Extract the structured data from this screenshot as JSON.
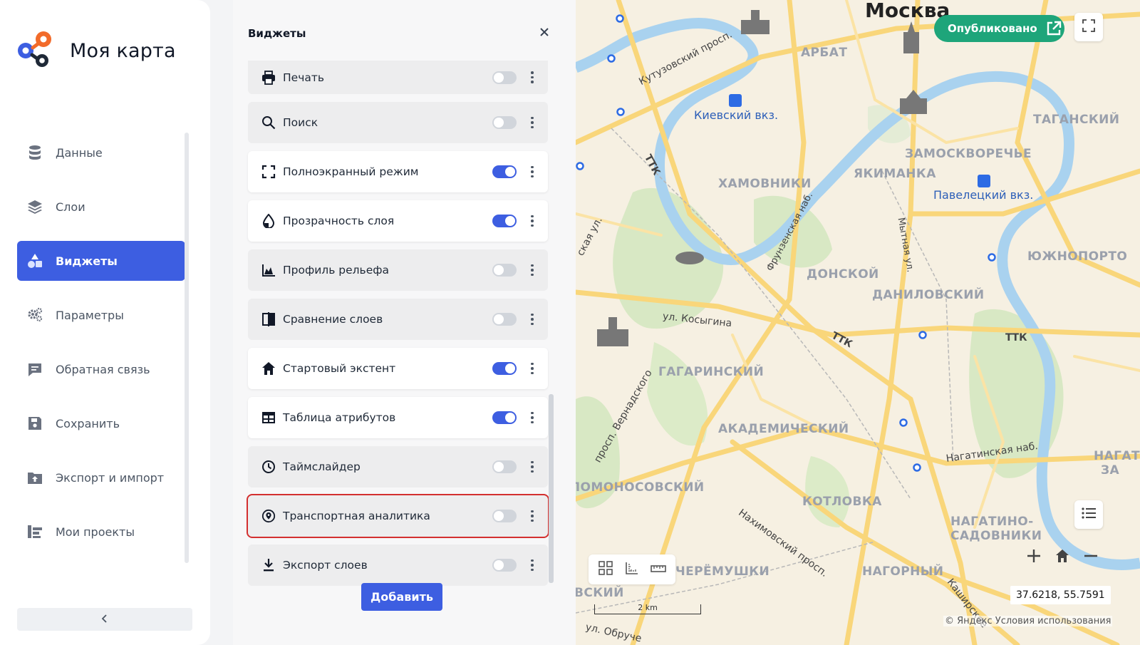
{
  "brand": {
    "title": "Моя карта"
  },
  "nav": {
    "items": [
      {
        "label": "Данные",
        "icon": "database-icon",
        "active": false
      },
      {
        "label": "Слои",
        "icon": "layers-icon",
        "active": false
      },
      {
        "label": "Виджеты",
        "icon": "widgets-icon",
        "active": true
      },
      {
        "label": "Параметры",
        "icon": "gears-icon",
        "active": false
      },
      {
        "label": "Обратная связь",
        "icon": "chat-icon",
        "active": false
      },
      {
        "label": "Сохранить",
        "icon": "save-icon",
        "active": false
      },
      {
        "label": "Экспорт и импорт",
        "icon": "folder-upload-icon",
        "active": false
      },
      {
        "label": "Мои проекты",
        "icon": "projects-icon",
        "active": false
      }
    ],
    "collapse_icon": "chevron-left-icon"
  },
  "panel": {
    "title": "Виджеты",
    "close_icon": "close-icon",
    "add_label": "Добавить",
    "widgets": [
      {
        "label": "Печать",
        "icon": "printer-icon",
        "enabled": false
      },
      {
        "label": "Поиск",
        "icon": "search-icon",
        "enabled": false
      },
      {
        "label": "Полноэкранный режим",
        "icon": "fullscreen-icon",
        "enabled": true
      },
      {
        "label": "Прозрачность слоя",
        "icon": "droplet-icon",
        "enabled": true
      },
      {
        "label": "Профиль рельефа",
        "icon": "elevation-chart-icon",
        "enabled": false
      },
      {
        "label": "Сравнение слоев",
        "icon": "compare-icon",
        "enabled": false
      },
      {
        "label": "Стартовый экстент",
        "icon": "home-icon",
        "enabled": true
      },
      {
        "label": "Таблица атрибутов",
        "icon": "table-icon",
        "enabled": true
      },
      {
        "label": "Таймслайдер",
        "icon": "clock-icon",
        "enabled": false
      },
      {
        "label": "Транспортная аналитика",
        "icon": "location-pin-icon",
        "enabled": false,
        "highlighted": true
      },
      {
        "label": "Экспорт слоев",
        "icon": "download-icon",
        "enabled": false
      }
    ]
  },
  "map": {
    "publish_label": "Опубликовано",
    "coords": "37.6218, 55.7591",
    "scale": "2 km",
    "copyright": "© Яндекс Условия использования",
    "labels": {
      "city": "Москва",
      "arbat": "АРБАТ",
      "kutuzovsky": "Кутузовский просп.",
      "kievsky": "Киевский вкз.",
      "tagansky": "ТАГАНСКИЙ",
      "zamoskvorechye": "ЗАМОСКВОРЕЧЬЕ",
      "yakimanka": "ЯКИМАНКА",
      "khamovniki": "ХАМОВНИКИ",
      "paveletsky": "Павелецкий вкз.",
      "ttk1": "ТТК",
      "frunzenskaya": "Фрунзенская наб.",
      "mytnaya": "Мытная ул.",
      "yuzhnoport": "ЮЖНОПОРТО",
      "donskoy": "ДОНСКОЙ",
      "danilovsky": "ДАНИЛОВСКИЙ",
      "kosygina": "ул. Косыгина",
      "ttk2": "ТТК",
      "ttk3": "ТТК",
      "gagarinsky": "ГАГАРИНСКИЙ",
      "vernadskogo": "просп. Вернадского",
      "akademichesky": "АКАДЕМИЧЕСКИЙ",
      "nagatinskaya": "Нагатинская наб.",
      "lomonosovsky": "ЛОМОНОСОВСКИЙ",
      "kotlovka": "КОТЛОВКА",
      "nakhimovsky": "Нахимовский просп.",
      "nagatino": "НАГАТИНО-",
      "sadovniki": "САДОВНИКИ",
      "cheryomushki": "ЧЕРЁМУШКИ",
      "nagorny": "НАГОРНЫЙ",
      "kashirskoye": "Каширское",
      "vsky": "ВСКИЙ",
      "nagati": "НАГАТ",
      "za": "ЗА",
      "obruch": "ул. Обруче",
      "skaya": "ская ул."
    }
  }
}
